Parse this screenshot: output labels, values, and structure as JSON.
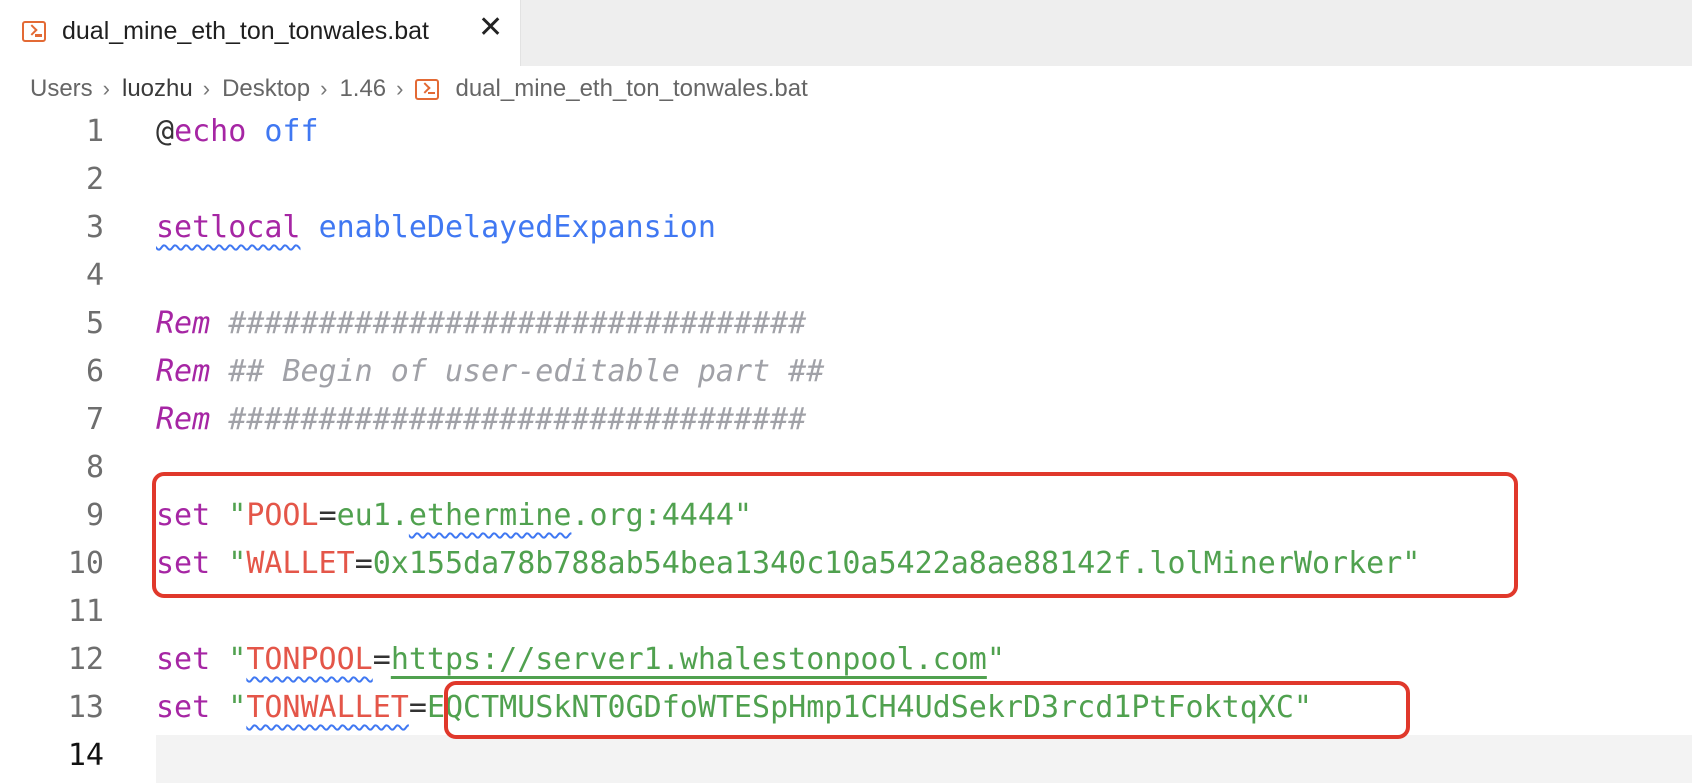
{
  "tab": {
    "filename": "dual_mine_eth_ton_tonwales.bat",
    "close_glyph": "✕",
    "icon": "terminal-file-icon"
  },
  "breadcrumb": {
    "items": [
      "Users",
      "luozhu",
      "Desktop",
      "1.46",
      "dual_mine_eth_ton_tonwales.bat"
    ],
    "separator": "›"
  },
  "editor": {
    "active_line": "14",
    "lines": [
      {
        "num": "1",
        "tokens": [
          "@",
          "echo",
          " ",
          "off"
        ]
      },
      {
        "num": "2",
        "tokens": []
      },
      {
        "num": "3",
        "tokens": [
          "setlocal",
          " ",
          "enableDelayedExpansion"
        ]
      },
      {
        "num": "4",
        "tokens": []
      },
      {
        "num": "5",
        "tokens": [
          "Rem",
          " ",
          "################################"
        ]
      },
      {
        "num": "6",
        "tokens": [
          "Rem",
          " ",
          "## Begin of user-editable part ##"
        ]
      },
      {
        "num": "7",
        "tokens": [
          "Rem",
          " ",
          "################################"
        ]
      },
      {
        "num": "8",
        "tokens": []
      },
      {
        "num": "9",
        "tokens": [
          "set",
          " \"",
          "POOL",
          "=",
          "eu1.",
          "ethermine",
          ".org:4444\""
        ]
      },
      {
        "num": "10",
        "tokens": [
          "set",
          " \"",
          "WALLET",
          "=",
          "0x155da78b788ab54bea1340c10a5422a8ae88142f.lolMinerWorker\""
        ]
      },
      {
        "num": "11",
        "tokens": []
      },
      {
        "num": "12",
        "tokens": [
          "set",
          " \"",
          "TONPOOL",
          "=",
          "https://server1.whalestonpool.com",
          "\""
        ]
      },
      {
        "num": "13",
        "tokens": [
          "set",
          " \"",
          "TONWALLET",
          "=",
          "EQCTMUSkNT0GDfoWTESpHmp1CH4UdSekrD3rcd1PtFoktqXC\""
        ]
      },
      {
        "num": "14",
        "tokens": []
      }
    ]
  },
  "colors": {
    "keyword": "#a626a4",
    "string": "#50a14f",
    "variable": "#e45649",
    "comment": "#a0a1a7",
    "builtin": "#4078f2",
    "highlight_box": "#e0382b"
  }
}
